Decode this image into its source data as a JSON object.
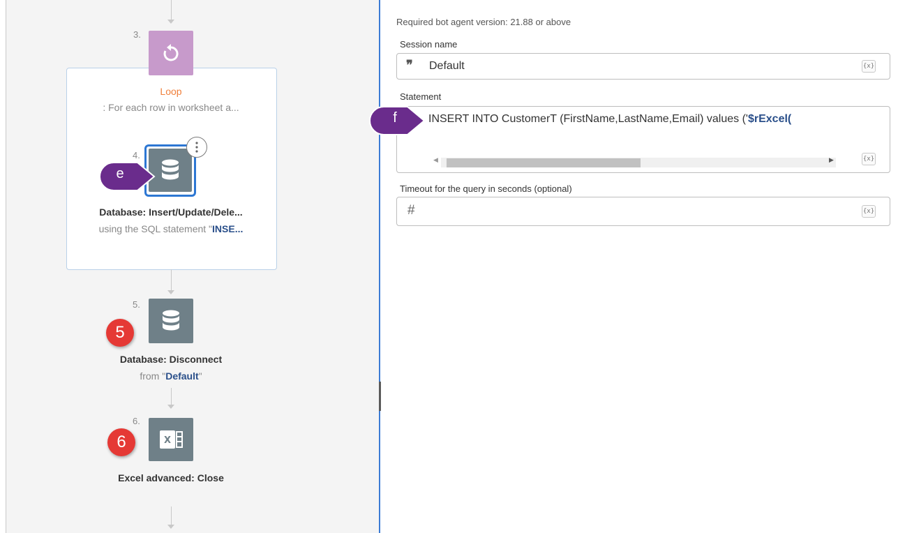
{
  "flow": {
    "steps": [
      {
        "number": "3.",
        "title": "Loop",
        "subtitle": ": For each row in worksheet a..."
      },
      {
        "number": "4.",
        "title": "Database: Insert/Update/Dele...",
        "subtitle_prefix": "using the SQL statement \"",
        "subtitle_bold": "INSE..."
      },
      {
        "number": "5.",
        "title": "Database: Disconnect",
        "subtitle_prefix": "from \"",
        "subtitle_bold": "Default",
        "subtitle_suffix": "\""
      },
      {
        "number": "6.",
        "title": "Excel advanced: Close"
      }
    ],
    "badges": {
      "e": "e",
      "five": "5",
      "six": "6",
      "f": "f"
    },
    "icons": {
      "loop": "loop-icon",
      "database": "database-icon",
      "excel": "excel-icon",
      "menu": "kebab-menu-icon"
    }
  },
  "panel": {
    "version_note": "Required bot agent version: 21.88 or above",
    "session": {
      "label": "Session name",
      "value": "Default",
      "icon": "quote-icon"
    },
    "statement": {
      "label": "Statement",
      "value_prefix": "INSERT INTO CustomerT (FirstName,LastName,Email) values ('",
      "value_bold": "$rExcel("
    },
    "timeout": {
      "label": "Timeout for the query in seconds (optional)",
      "icon": "hash-icon"
    },
    "var_button": "{x}"
  },
  "colors": {
    "accent_blue": "#2d77d3",
    "loop_title": "#f0803c",
    "tile_gray": "#6f8088",
    "tile_purple": "#c79acb",
    "badge_red": "#e53935",
    "badge_purple": "#6a2c8c"
  }
}
